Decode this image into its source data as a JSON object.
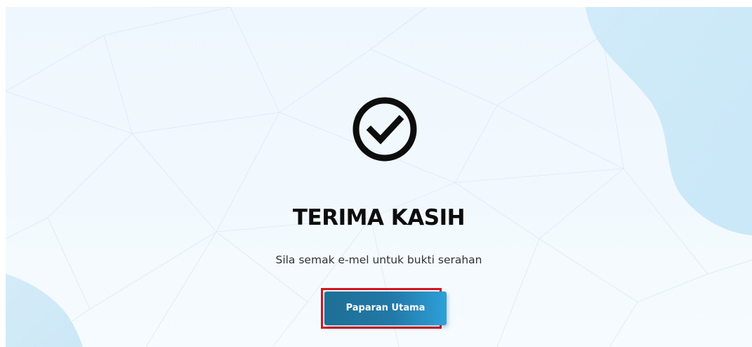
{
  "page": {
    "check_icon": "check-circle-icon",
    "title": "TERIMA KASIH",
    "subtitle": "Sila semak e-mel untuk bukti serahan",
    "home_button": {
      "label": "Paparan Utama"
    }
  },
  "colors": {
    "accent_button_start": "#1d6f95",
    "accent_button_end": "#2ea0d8",
    "highlight_border": "#d7141c",
    "background": "#eef7fd",
    "title_text": "#0d0d0d"
  }
}
